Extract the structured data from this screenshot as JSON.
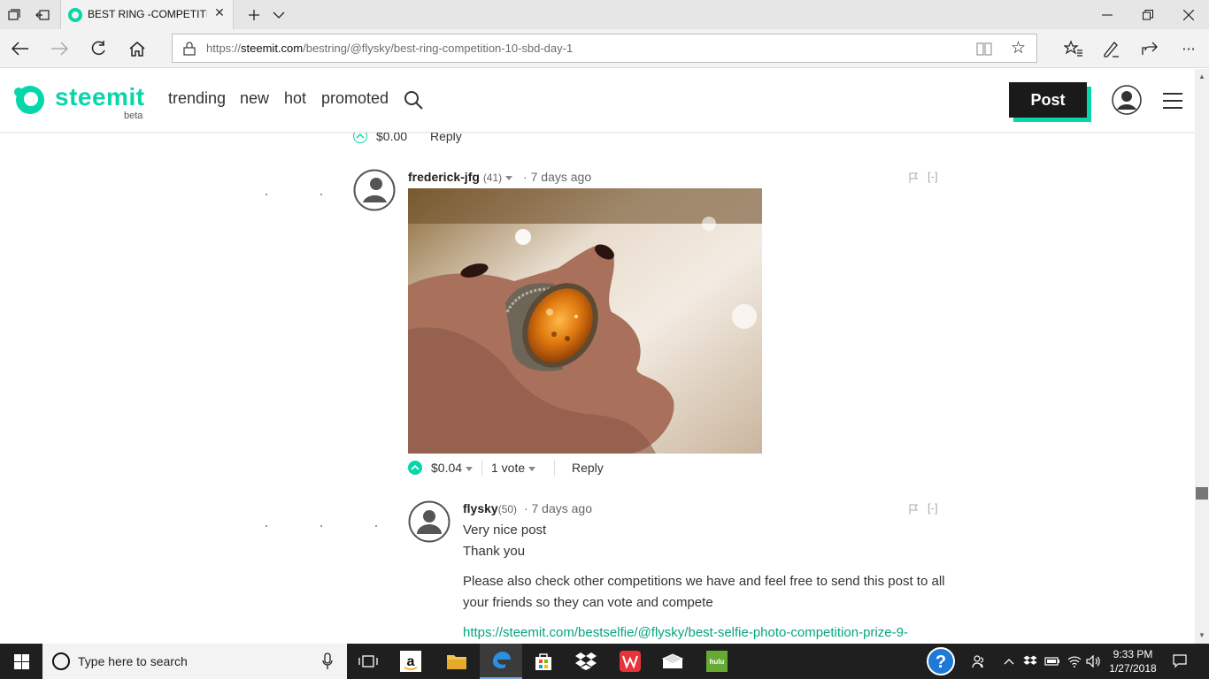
{
  "browser": {
    "tab_title": "BEST RING -COMPETITI",
    "url_prefix": "https://",
    "url_domain": "steemit.com",
    "url_path": "/bestring/@flysky/best-ring-competition-10-sbd-day-1"
  },
  "site": {
    "logo_text": "steemit",
    "beta_label": "beta",
    "nav": [
      "trending",
      "new",
      "hot",
      "promoted"
    ],
    "post_button": "Post",
    "accent_color": "#06d6a9"
  },
  "prev_comment": {
    "payout": "$0.00",
    "reply": "Reply"
  },
  "comment1": {
    "author": "frederick-jfg",
    "reputation": "(41)",
    "age": "7 days ago",
    "collapse": "[-]",
    "payout": "$0.04",
    "votes": "1 vote",
    "reply": "Reply",
    "image_alt": "amber-ring-photo"
  },
  "comment2": {
    "author": "flysky",
    "reputation": "(50)",
    "age": "7 days ago",
    "collapse": "[-]",
    "line1": "Very nice post",
    "line2": "Thank you",
    "paragraph_line1": "Please also check other competitions we have and feel free to send this post to all",
    "paragraph_line2": "your friends so they can vote and compete",
    "link": "https://steemit.com/bestselfie/@flysky/best-selfie-photo-competition-prize-9-"
  },
  "taskbar": {
    "search_placeholder": "Type here to search",
    "time": "9:33 PM",
    "date": "1/27/2018"
  }
}
